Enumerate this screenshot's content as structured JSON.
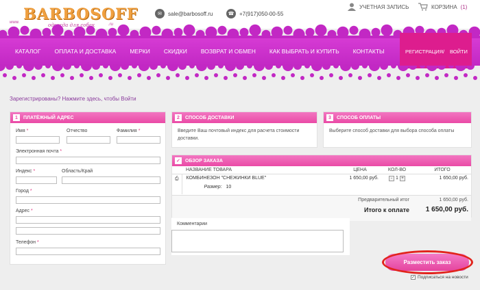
{
  "logo": {
    "text": "BARBOSOFF",
    "tagline": "одежда для собак",
    "www": "www.",
    "ru": ".ru"
  },
  "contacts": {
    "email": "sale@barbosoff.ru",
    "phone": "+7(917)050-00-55"
  },
  "account": {
    "label": "УЧЕТНАЯ ЗАПИСЬ",
    "cart_label": "КОРЗИНА",
    "cart_count": "(1)"
  },
  "nav": [
    "КАТАЛОГ",
    "ОПЛАТА И ДОСТАВКА",
    "МЕРКИ",
    "СКИДКИ",
    "ВОЗВРАТ И ОБМЕН",
    "КАК ВЫБРАТЬ И КУПИТЬ",
    "КОНТАКТЫ"
  ],
  "auth": {
    "register": "РЕГИСТРАЦИЯ",
    "separator": "/",
    "login": "ВОЙТИ"
  },
  "login_prompt": "Зарегистрированы? Нажмите здесь, чтобы Войти",
  "billing": {
    "num": "1",
    "title": "ПЛАТЁЖНЫЙ АДРЕС",
    "name": "Имя",
    "patronymic": "Отчество",
    "surname": "Фамилия",
    "email": "Электронная почта",
    "zip": "Индекс",
    "region": "Область/Край",
    "city": "Город",
    "address": "Адрес",
    "phone": "Телефон",
    "required_mark": "*"
  },
  "shipping": {
    "num": "2",
    "title": "СПОСОБ ДОСТАВКИ",
    "text": "Введите Ваш почтовый индекс для расчета стоимости доставки."
  },
  "payment": {
    "num": "3",
    "title": "СПОСОБ ОПЛАТЫ",
    "text": "Выберите способ доставки для выбора способа оплаты"
  },
  "review": {
    "title": "ОБЗОР ЗАКАЗА",
    "columns": {
      "name": "НАЗВАНИЕ ТОВАРА",
      "price": "ЦЕНА",
      "qty": "КОЛ-ВО",
      "total": "ИТОГО"
    },
    "item": {
      "name": "КОМБИНЕЗОН \"СНЕЖИНКИ BLUE\"",
      "size_label": "Размер:",
      "size": "10",
      "price": "1 650,00 руб.",
      "qty": "1",
      "total": "1 650,00 руб.",
      "minus": "-",
      "plus": "+"
    },
    "subtotal_label": "Предварительный итог",
    "subtotal": "1 650,00 руб.",
    "grand_label": "Итого к оплате",
    "grand": "1 650,00 руб."
  },
  "comments_label": "Комментарии",
  "submit_label": "Разместить заказ",
  "subscribe_label": "Подписаться на новости",
  "colors": {
    "accent": "#ea4aa6",
    "nav": "#c228c4",
    "reg": "#dd1d8e"
  }
}
